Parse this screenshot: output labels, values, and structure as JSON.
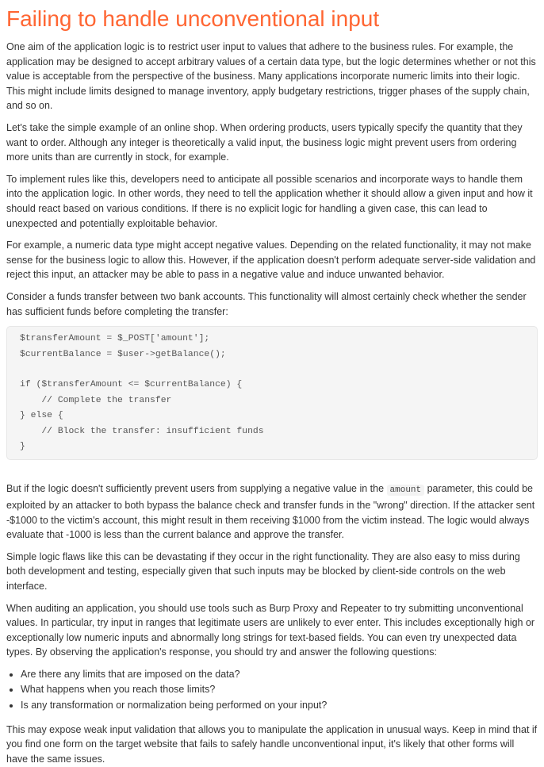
{
  "title": "Failing to handle unconventional input",
  "paragraphs": [
    "One aim of the application logic is to restrict user input to values that adhere to the business rules. For example, the application may be designed to accept arbitrary values of a certain data type, but the logic determines whether or not this value is acceptable from the perspective of the business. Many applications incorporate numeric limits into their logic. This might include limits designed to manage inventory, apply budgetary restrictions, trigger phases of the supply chain, and so on.",
    "Let's take the simple example of an online shop. When ordering products, users typically specify the quantity that they want to order. Although any integer is theoretically a valid input, the business logic might prevent users from ordering more units than are currently in stock, for example.",
    "To implement rules like this, developers need to anticipate all possible scenarios and incorporate ways to handle them into the application logic. In other words, they need to tell the application whether it should allow a given input and how it should react based on various conditions. If there is no explicit logic for handling a given case, this can lead to unexpected and potentially exploitable behavior.",
    "For example, a numeric data type might accept negative values. Depending on the related functionality, it may not make sense for the business logic to allow this. However, if the application doesn't perform adequate server-side validation and reject this input, an attacker may be able to pass in a negative value and induce unwanted behavior.",
    "Consider a funds transfer between two bank accounts. This functionality will almost certainly check whether the sender has sufficient funds before completing the transfer:"
  ],
  "code_lines": [
    "$transferAmount = $_POST['amount'];",
    "$currentBalance = $user->getBalance();",
    "",
    "if ($transferAmount <= $currentBalance) {",
    "    // Complete the transfer",
    "} else {",
    "    // Block the transfer: insufficient funds",
    "}"
  ],
  "para_after_code": {
    "before": "But if the logic doesn't sufficiently prevent users from supplying a negative value in the ",
    "code": "amount",
    "after": " parameter, this could be exploited by an attacker to both bypass the balance check and transfer funds in the \"wrong\" direction. If the attacker sent -$1000 to the victim's account, this might result in them receiving $1000 from the victim instead. The logic would always evaluate that -1000 is less than the current balance and approve the transfer."
  },
  "paragraphs_2": [
    "Simple logic flaws like this can be devastating if they occur in the right functionality. They are also easy to miss during both development and testing, especially given that such inputs may be blocked by client-side controls on the web interface.",
    "When auditing an application, you should use tools such as Burp Proxy and Repeater to try submitting unconventional values. In particular, try input in ranges that legitimate users are unlikely to ever enter. This includes exceptionally high or exceptionally low numeric inputs and abnormally long strings for text-based fields. You can even try unexpected data types. By observing the application's response, you should try and answer the following questions:"
  ],
  "questions": [
    "Are there any limits that are imposed on the data?",
    "What happens when you reach those limits?",
    "Is any transformation or normalization being performed on your input?"
  ],
  "closing": "This may expose weak input validation that allows you to manipulate the application in unusual ways. Keep in mind that if you find one form on the target website that fails to safely handle unconventional input, it's likely that other forms will have the same issues."
}
